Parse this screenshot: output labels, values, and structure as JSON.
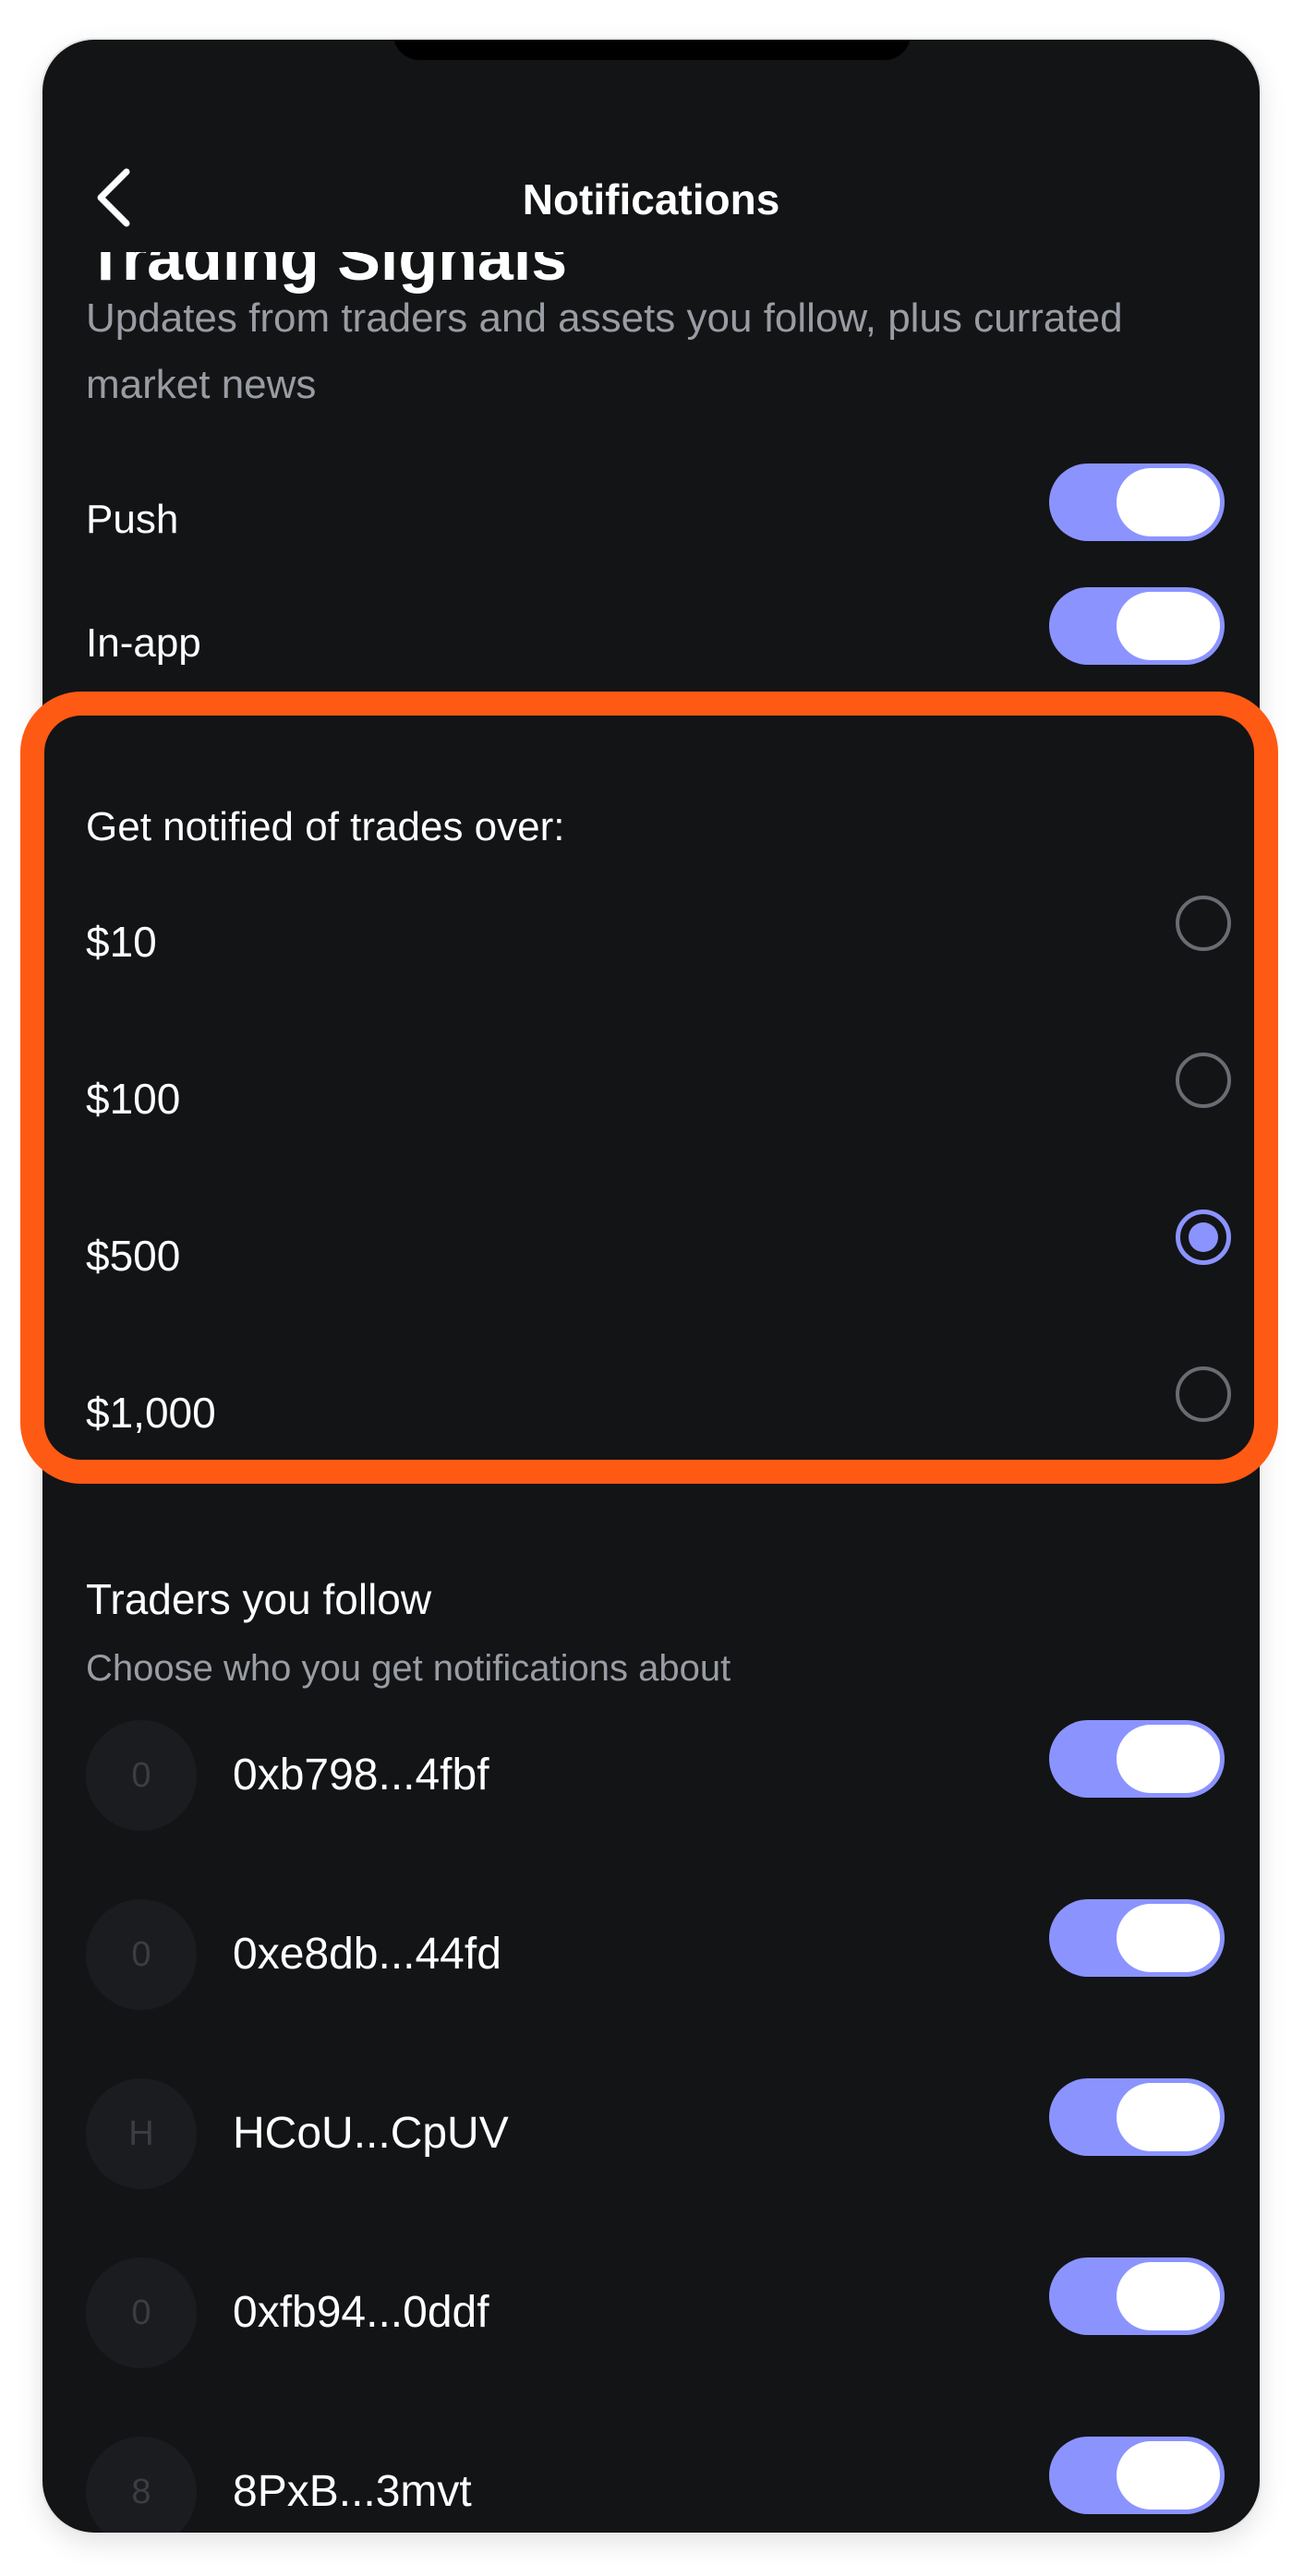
{
  "header": {
    "title": "Notifications"
  },
  "section": {
    "title": "Trading Signals",
    "subtitle": "Updates from traders and assets you follow, plus currated market news"
  },
  "channels": [
    {
      "label": "Push",
      "enabled": true
    },
    {
      "label": "In-app",
      "enabled": true
    }
  ],
  "threshold": {
    "title": "Get notified of trades over:",
    "options": [
      {
        "label": "$10",
        "selected": false
      },
      {
        "label": "$100",
        "selected": false
      },
      {
        "label": "$500",
        "selected": true
      },
      {
        "label": "$1,000",
        "selected": false
      }
    ]
  },
  "traders": {
    "title": "Traders you follow",
    "subtitle": "Choose who you get notifications about",
    "items": [
      {
        "initial": "0",
        "name": "0xb798...4fbf",
        "enabled": true
      },
      {
        "initial": "0",
        "name": "0xe8db...44fd",
        "enabled": true
      },
      {
        "initial": "H",
        "name": "HCoU...CpUV",
        "enabled": true
      },
      {
        "initial": "0",
        "name": "0xfb94...0ddf",
        "enabled": true
      },
      {
        "initial": "8",
        "name": "8PxB...3mvt",
        "enabled": true
      }
    ]
  },
  "colors": {
    "background": "#131416",
    "accent": "#8b93ff",
    "highlight": "#ff5a14",
    "muted_text": "#9a9ca3"
  }
}
